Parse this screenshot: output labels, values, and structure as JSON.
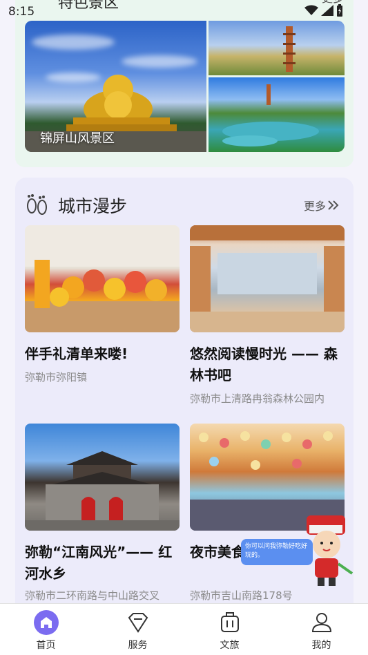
{
  "status_bar": {
    "time": "8:15"
  },
  "scenic": {
    "title": "特色景区",
    "more": "更多",
    "featured_label": "锦屏山风景区"
  },
  "city_walk": {
    "title": "城市漫步",
    "more": "更多",
    "items": [
      {
        "title": "伴手礼清单来喽!",
        "location": "弥勒市弥阳镇"
      },
      {
        "title": "悠然阅读慢时光 —— 森林书吧",
        "location": "弥勒市上清路冉翁森林公园内"
      },
      {
        "title": "弥勒“江南风光”—— 红河水乡",
        "location": "弥勒市二环南路与中山路交叉"
      },
      {
        "title": "夜市美食 锦绣花街",
        "location": "弥勒市吉山南路178号"
      }
    ]
  },
  "assistant": {
    "bubble_text": "你可以问我弥勒好吃好玩的。"
  },
  "bottom_nav": {
    "items": [
      {
        "label": "首页",
        "icon": "home-icon",
        "active": true
      },
      {
        "label": "服务",
        "icon": "service-icon",
        "active": false
      },
      {
        "label": "文旅",
        "icon": "travel-icon",
        "active": false
      },
      {
        "label": "我的",
        "icon": "profile-icon",
        "active": false
      }
    ]
  },
  "colors": {
    "accent": "#7b6cf0",
    "walk_card_bg": "#ecebfa",
    "scenic_card_bg": "#eaf6ef"
  }
}
